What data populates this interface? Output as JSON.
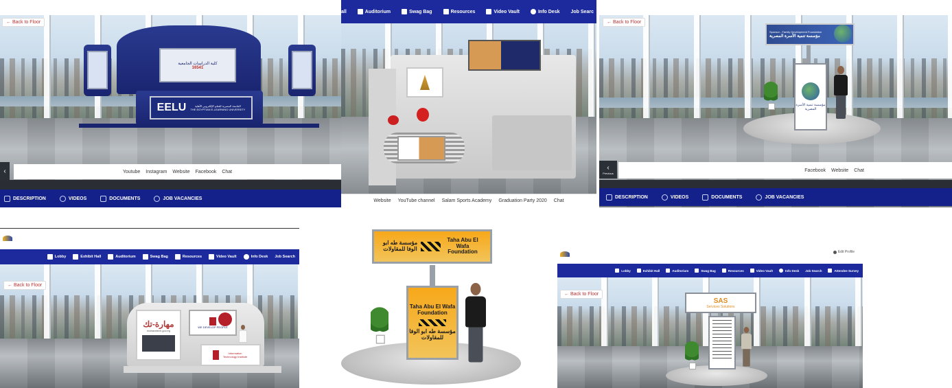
{
  "panel1": {
    "back_label": "← Back to Floor",
    "booth_main_text": "EELU",
    "booth_subtitle_ar": "الجامعة المصرية للتعلم الإلكتروني الأهلية",
    "booth_subtitle_en": "THE EGYPTIAN E-LEARNING UNIVERSITY",
    "banner_ar": "كلية الدراسات الجامعية",
    "banner_number": "16541",
    "links": [
      "Youtube",
      "Instagram",
      "Website",
      "Facebook",
      "Chat"
    ],
    "tabs": [
      {
        "label": "DESCRIPTION",
        "icon": "building-icon"
      },
      {
        "label": "VIDEOS",
        "icon": "play-icon"
      },
      {
        "label": "DOCUMENTS",
        "icon": "document-icon"
      },
      {
        "label": "JOB VACANCIES",
        "icon": "user-tie-icon"
      }
    ]
  },
  "panel2": {
    "nav": [
      {
        "label": "all",
        "icon": ""
      },
      {
        "label": "Auditorium",
        "icon": "table-icon"
      },
      {
        "label": "Swag Bag",
        "icon": "bag-icon"
      },
      {
        "label": "Resources",
        "icon": "folder-icon"
      },
      {
        "label": "Video Vault",
        "icon": "video-icon"
      },
      {
        "label": "Info Desk",
        "icon": "info-icon"
      },
      {
        "label": "Job Searc",
        "icon": ""
      }
    ],
    "links": [
      "Website",
      "YouTube channel",
      "Salam Sports Academy",
      "Graduation Party 2020",
      "Chat"
    ]
  },
  "panel3": {
    "back_label": "← Back to Floor",
    "sign_title": "Sponsor - Family Development Foundation",
    "sign_ar": "مؤسسة تنمية الأسرة المصرية",
    "banner_ar": "مؤسسة تنمية الأسرة المصرية",
    "prev_label": "Previous",
    "links": [
      "Facebook",
      "Website",
      "Chat"
    ],
    "tabs": [
      {
        "label": "DESCRIPTION",
        "icon": "building-icon"
      },
      {
        "label": "VIDEOS",
        "icon": "play-icon"
      },
      {
        "label": "DOCUMENTS",
        "icon": "document-icon"
      },
      {
        "label": "JOB VACANCIES",
        "icon": "user-tie-icon"
      }
    ]
  },
  "panel4": {
    "nav": [
      {
        "label": "Lobby",
        "icon": "door-icon"
      },
      {
        "label": "Exhibit Hall",
        "icon": "building-icon"
      },
      {
        "label": "Auditorium",
        "icon": "table-icon"
      },
      {
        "label": "Swag Bag",
        "icon": "bag-icon"
      },
      {
        "label": "Resources",
        "icon": "folder-icon"
      },
      {
        "label": "Video Vault",
        "icon": "video-icon"
      },
      {
        "label": "Info Desk",
        "icon": "info-icon"
      },
      {
        "label": "Job Search",
        "icon": ""
      }
    ],
    "back_label": "← Back to Floor",
    "booth_ar": "مهارة-تك",
    "booth_sub": "maharatech.gov.eg",
    "iti_slogan": "WE DEVELOP PEOPLE",
    "iti_name": "Information Technology Institute"
  },
  "panel5": {
    "top_ar": "مؤسسة طه ابو الوفا للمقاولات",
    "top_en": "Taha Abu El Wafa Foundation",
    "stand_en": "Taha Abu El Wafa Foundation",
    "stand_ar": "مؤسسة طه ابو الوفا للمقاولات"
  },
  "panel6": {
    "profile_label": "Edit Profile",
    "nav": [
      {
        "label": "Lobby",
        "icon": "door-icon"
      },
      {
        "label": "Exhibit Hall",
        "icon": "building-icon"
      },
      {
        "label": "Auditorium",
        "icon": "table-icon"
      },
      {
        "label": "Swag Bag",
        "icon": "bag-icon"
      },
      {
        "label": "Resources",
        "icon": "folder-icon"
      },
      {
        "label": "Video Vault",
        "icon": "video-icon"
      },
      {
        "label": "Info Desk",
        "icon": "info-icon"
      },
      {
        "label": "Job Search",
        "icon": ""
      },
      {
        "label": "Attendee Survey",
        "icon": "edit-icon"
      }
    ],
    "back_label": "← Back to Floor",
    "sign_brand": "SAS",
    "sign_company": "Services Solutions"
  }
}
